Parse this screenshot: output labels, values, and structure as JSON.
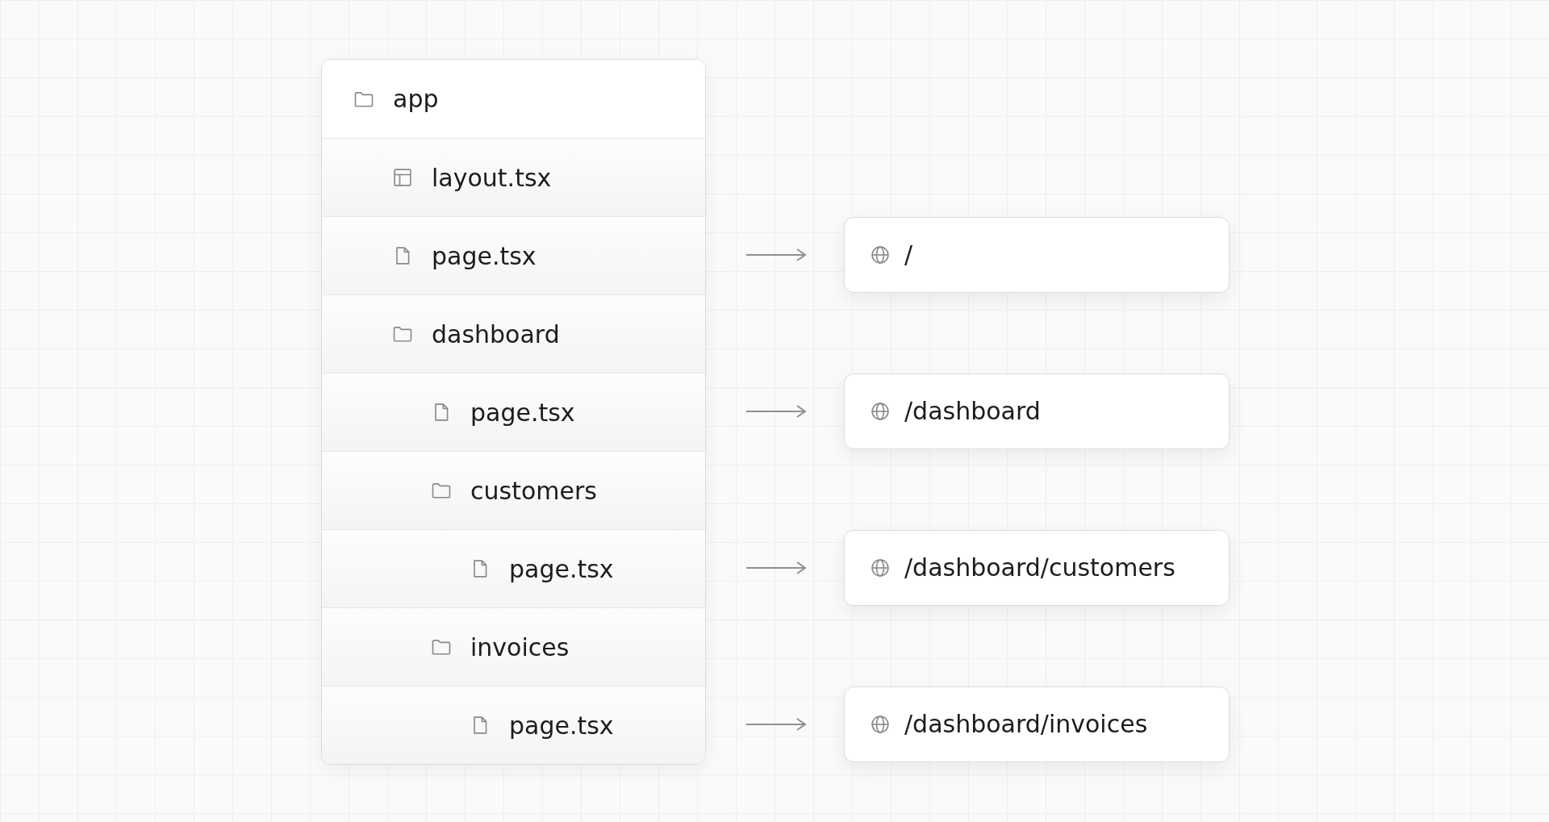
{
  "tree": [
    {
      "name": "app",
      "kind": "folder",
      "children": [
        {
          "name": "layout.tsx",
          "kind": "layout"
        },
        {
          "name": "page.tsx",
          "kind": "page",
          "route": "/"
        },
        {
          "name": "dashboard",
          "kind": "folder",
          "children": [
            {
              "name": "page.tsx",
              "kind": "page",
              "route": "/dashboard"
            },
            {
              "name": "customers",
              "kind": "folder",
              "children": [
                {
                  "name": "page.tsx",
                  "kind": "page",
                  "route": "/dashboard/customers"
                }
              ]
            },
            {
              "name": "invoices",
              "kind": "folder",
              "children": [
                {
                  "name": "page.tsx",
                  "kind": "page",
                  "route": "/dashboard/invoices"
                }
              ]
            }
          ]
        }
      ]
    }
  ]
}
